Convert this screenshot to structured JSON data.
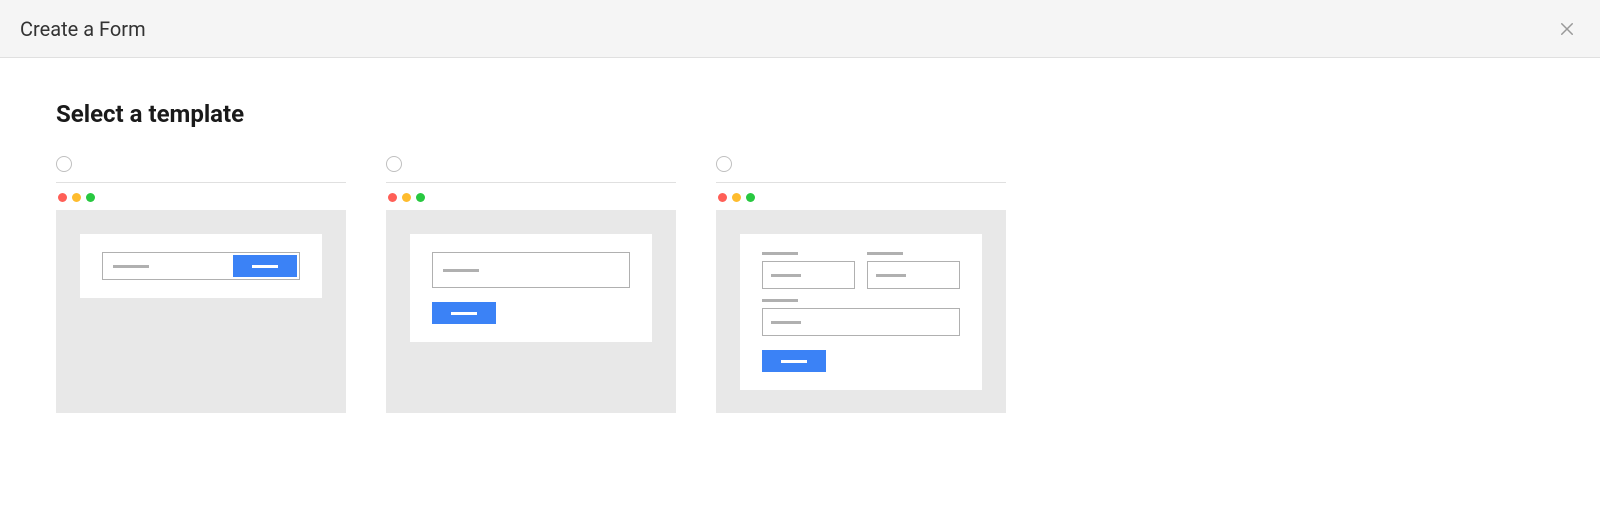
{
  "header": {
    "title": "Create a Form"
  },
  "section": {
    "title": "Select a template"
  },
  "templates": [
    {
      "id": "inline",
      "label": ""
    },
    {
      "id": "stacked",
      "label": ""
    },
    {
      "id": "multi-field",
      "label": ""
    }
  ],
  "colors": {
    "accent": "#3b82f6",
    "preview_bg": "#e8e8e8",
    "border": "#b0b0b0"
  }
}
